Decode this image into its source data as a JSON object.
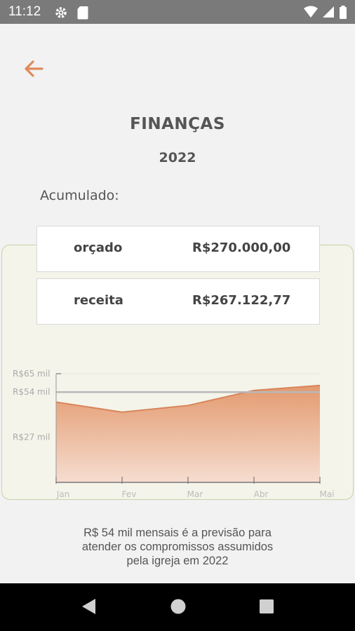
{
  "status_bar": {
    "time": "11:12"
  },
  "header": {
    "title": "FINANÇAS",
    "year": "2022"
  },
  "accumulated_label": "Acumulado:",
  "summary": [
    {
      "label": "orçado",
      "value": "R$270.000,00"
    },
    {
      "label": "receita",
      "value": "R$267.122,77"
    }
  ],
  "chart_data": {
    "type": "area",
    "categories": [
      "Jan",
      "Fev",
      "Mar",
      "Abr",
      "Mai"
    ],
    "values": [
      48,
      42,
      46,
      55,
      58
    ],
    "reference_line": 54,
    "y_tick_labels": [
      "R$65 mil",
      "R$54 mil",
      "R$27 mil"
    ],
    "y_tick_values": [
      65,
      54,
      27
    ],
    "ylim": [
      0,
      65
    ],
    "area_color_top": "#e39a6f",
    "area_color_bottom": "#f6ddd0",
    "line_color": "#d9855a",
    "reference_color": "#b8b8b8"
  },
  "footer": {
    "lines": [
      "R$ 54 mil mensais é a previsão para",
      "atender os compromissos assumidos",
      "pela igreja em 2022"
    ]
  },
  "accent_color": "#e08a5c"
}
